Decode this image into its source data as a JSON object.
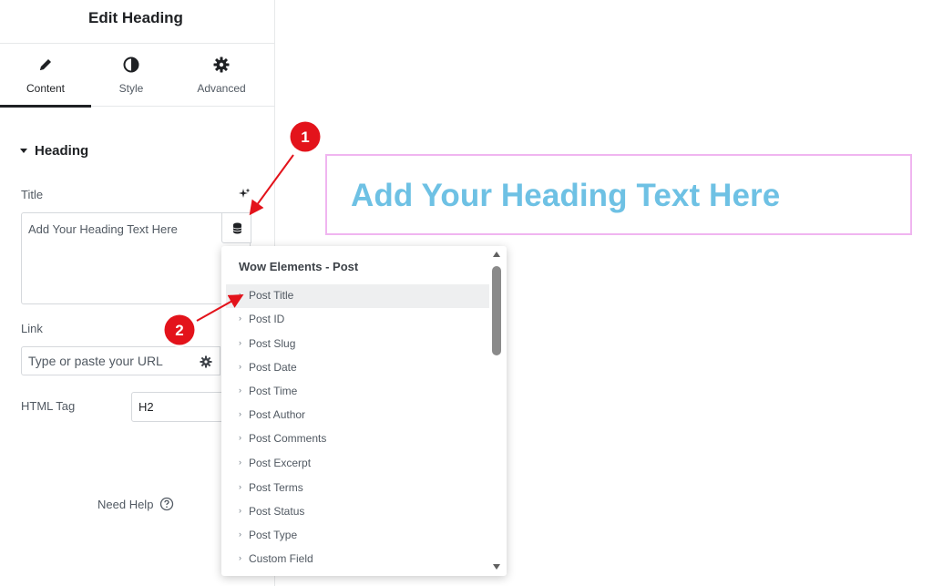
{
  "panel": {
    "title": "Edit Heading",
    "tabs": [
      {
        "label": "Content",
        "icon": "pencil-icon",
        "active": true
      },
      {
        "label": "Style",
        "icon": "half-circle-icon",
        "active": false
      },
      {
        "label": "Advanced",
        "icon": "gear-icon",
        "active": false
      }
    ],
    "section": {
      "label": "Heading",
      "icon": "caret-down-icon"
    },
    "title_field": {
      "label": "Title",
      "value": "Add Your Heading Text Here",
      "ai_icon": "sparkle-icon",
      "dynamic_icon": "database-icon"
    },
    "link_field": {
      "label": "Link",
      "placeholder": "Type or paste your URL",
      "options_icon": "gear-icon"
    },
    "html_tag": {
      "label": "HTML Tag",
      "value": "H2"
    },
    "help": {
      "label": "Need Help",
      "icon": "question-circle-icon"
    }
  },
  "canvas": {
    "heading": "Add Your Heading Text Here",
    "heading_color": "#6ec1e4",
    "outline_color": "#f0b5f0"
  },
  "dropdown": {
    "group": "Wow Elements - Post",
    "items": [
      "Post Title",
      "Post ID",
      "Post Slug",
      "Post Date",
      "Post Time",
      "Post Author",
      "Post Comments",
      "Post Excerpt",
      "Post Terms",
      "Post Status",
      "Post Type",
      "Custom Field"
    ],
    "highlighted": "Post Title"
  },
  "annotations": {
    "badges": [
      "1",
      "2"
    ],
    "color": "#e3131b"
  }
}
